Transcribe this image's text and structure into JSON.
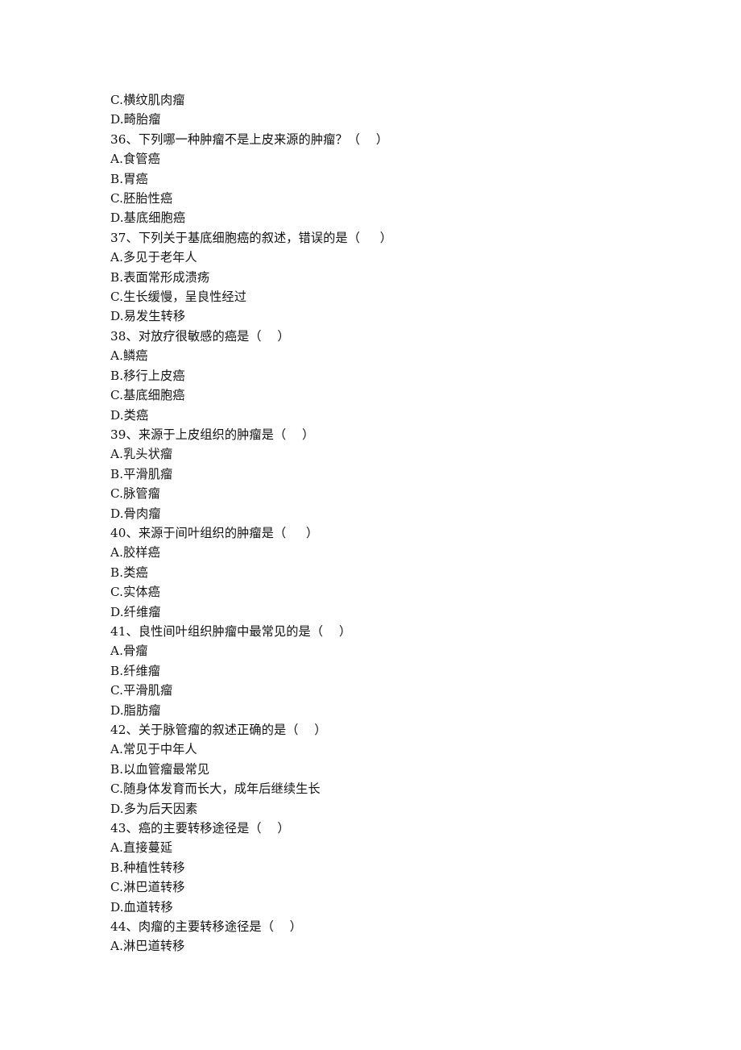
{
  "document": {
    "background_color": "#ffffff",
    "text_color": "#161616",
    "lines": [
      {
        "id": "l1",
        "type": "option",
        "text": "C.横纹肌肉瘤"
      },
      {
        "id": "l2",
        "type": "option",
        "text": "D.畸胎瘤"
      },
      {
        "id": "l3",
        "type": "question",
        "text": "36、下列哪一种肿瘤不是上皮来源的肿瘤？（    ）"
      },
      {
        "id": "l4",
        "type": "option",
        "text": "A.食管癌"
      },
      {
        "id": "l5",
        "type": "option",
        "text": "B.胃癌"
      },
      {
        "id": "l6",
        "type": "option",
        "text": "C.胚胎性癌"
      },
      {
        "id": "l7",
        "type": "option",
        "text": "D.基底细胞癌"
      },
      {
        "id": "l8",
        "type": "question",
        "text": "37、下列关于基底细胞癌的叙述，错误的是（     ）"
      },
      {
        "id": "l9",
        "type": "option",
        "text": "A.多见于老年人"
      },
      {
        "id": "l10",
        "type": "option",
        "text": "B.表面常形成溃疡"
      },
      {
        "id": "l11",
        "type": "option",
        "text": "C.生长缓慢，呈良性经过"
      },
      {
        "id": "l12",
        "type": "option",
        "text": "D.易发生转移"
      },
      {
        "id": "l13",
        "type": "question",
        "text": "38、对放疗很敏感的癌是（    ）"
      },
      {
        "id": "l14",
        "type": "option",
        "text": "A.鳞癌"
      },
      {
        "id": "l15",
        "type": "option",
        "text": "B.移行上皮癌"
      },
      {
        "id": "l16",
        "type": "option",
        "text": "C.基底细胞癌"
      },
      {
        "id": "l17",
        "type": "option",
        "text": "D.类癌"
      },
      {
        "id": "l18",
        "type": "question",
        "text": "39、来源于上皮组织的肿瘤是（    ）"
      },
      {
        "id": "l19",
        "type": "option",
        "text": "A.乳头状瘤"
      },
      {
        "id": "l20",
        "type": "option",
        "text": "B.平滑肌瘤"
      },
      {
        "id": "l21",
        "type": "option",
        "text": "C.脉管瘤"
      },
      {
        "id": "l22",
        "type": "option",
        "text": "D.骨肉瘤"
      },
      {
        "id": "l23",
        "type": "question",
        "text": "40、来源于间叶组织的肿瘤是（     ）"
      },
      {
        "id": "l24",
        "type": "option",
        "text": "A.胶样癌"
      },
      {
        "id": "l25",
        "type": "option",
        "text": "B.类癌"
      },
      {
        "id": "l26",
        "type": "option",
        "text": "C.实体癌"
      },
      {
        "id": "l27",
        "type": "option",
        "text": "D.纤维瘤"
      },
      {
        "id": "l28",
        "type": "question",
        "text": "41、良性间叶组织肿瘤中最常见的是（    ）"
      },
      {
        "id": "l29",
        "type": "option",
        "text": "A.骨瘤"
      },
      {
        "id": "l30",
        "type": "option",
        "text": "B.纤维瘤"
      },
      {
        "id": "l31",
        "type": "option",
        "text": "C.平滑肌瘤"
      },
      {
        "id": "l32",
        "type": "option",
        "text": "D.脂肪瘤"
      },
      {
        "id": "l33",
        "type": "question",
        "text": "42、关于脉管瘤的叙述正确的是（    ）"
      },
      {
        "id": "l34",
        "type": "option",
        "text": "A.常见于中年人"
      },
      {
        "id": "l35",
        "type": "option",
        "text": "B.以血管瘤最常见"
      },
      {
        "id": "l36",
        "type": "option",
        "text": "C.随身体发育而长大，成年后继续生长"
      },
      {
        "id": "l37",
        "type": "option",
        "text": "D.多为后天因素"
      },
      {
        "id": "l38",
        "type": "question",
        "text": "43、癌的主要转移途径是（    ）"
      },
      {
        "id": "l39",
        "type": "option",
        "text": "A.直接蔓延"
      },
      {
        "id": "l40",
        "type": "option",
        "text": "B.种植性转移"
      },
      {
        "id": "l41",
        "type": "option",
        "text": "C.淋巴道转移"
      },
      {
        "id": "l42",
        "type": "option",
        "text": "D.血道转移"
      },
      {
        "id": "l43",
        "type": "question",
        "text": "44、肉瘤的主要转移途径是（    ）"
      },
      {
        "id": "l44",
        "type": "option",
        "text": "A.淋巴道转移"
      }
    ]
  }
}
